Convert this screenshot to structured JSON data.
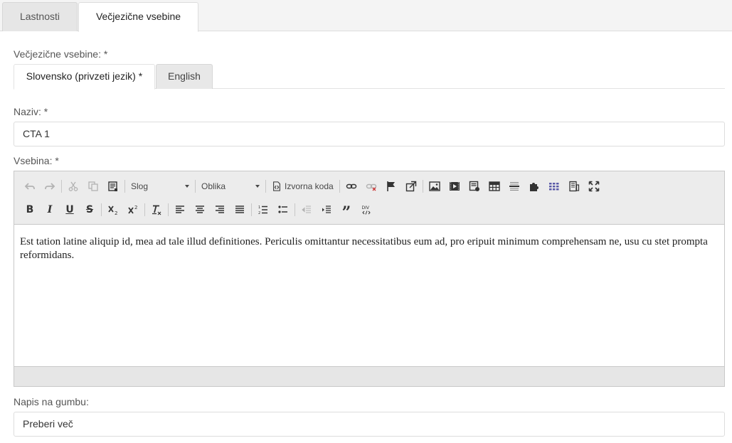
{
  "top_tabs": [
    {
      "label": "Lastnosti"
    },
    {
      "label": "Večjezične vsebine"
    }
  ],
  "multilang_label": "Večjezične vsebine: *",
  "lang_tabs": [
    {
      "label": "Slovensko (privzeti jezik) *"
    },
    {
      "label": "English"
    }
  ],
  "name_field": {
    "label": "Naziv: *",
    "value": "CTA 1"
  },
  "content_field": {
    "label": "Vsebina: *",
    "toolbar": {
      "style_combo": "Slog",
      "format_combo": "Oblika",
      "source_button": "Izvorna koda"
    },
    "text": "Est tation latine aliquip id, mea ad tale illud definitiones. Periculis omittantur necessitatibus eum ad, pro eripuit minimum comprehensam ne, usu cu stet prompta reformidans."
  },
  "button_field": {
    "label": "Napis na gumbu:",
    "value": "Preberi več"
  }
}
